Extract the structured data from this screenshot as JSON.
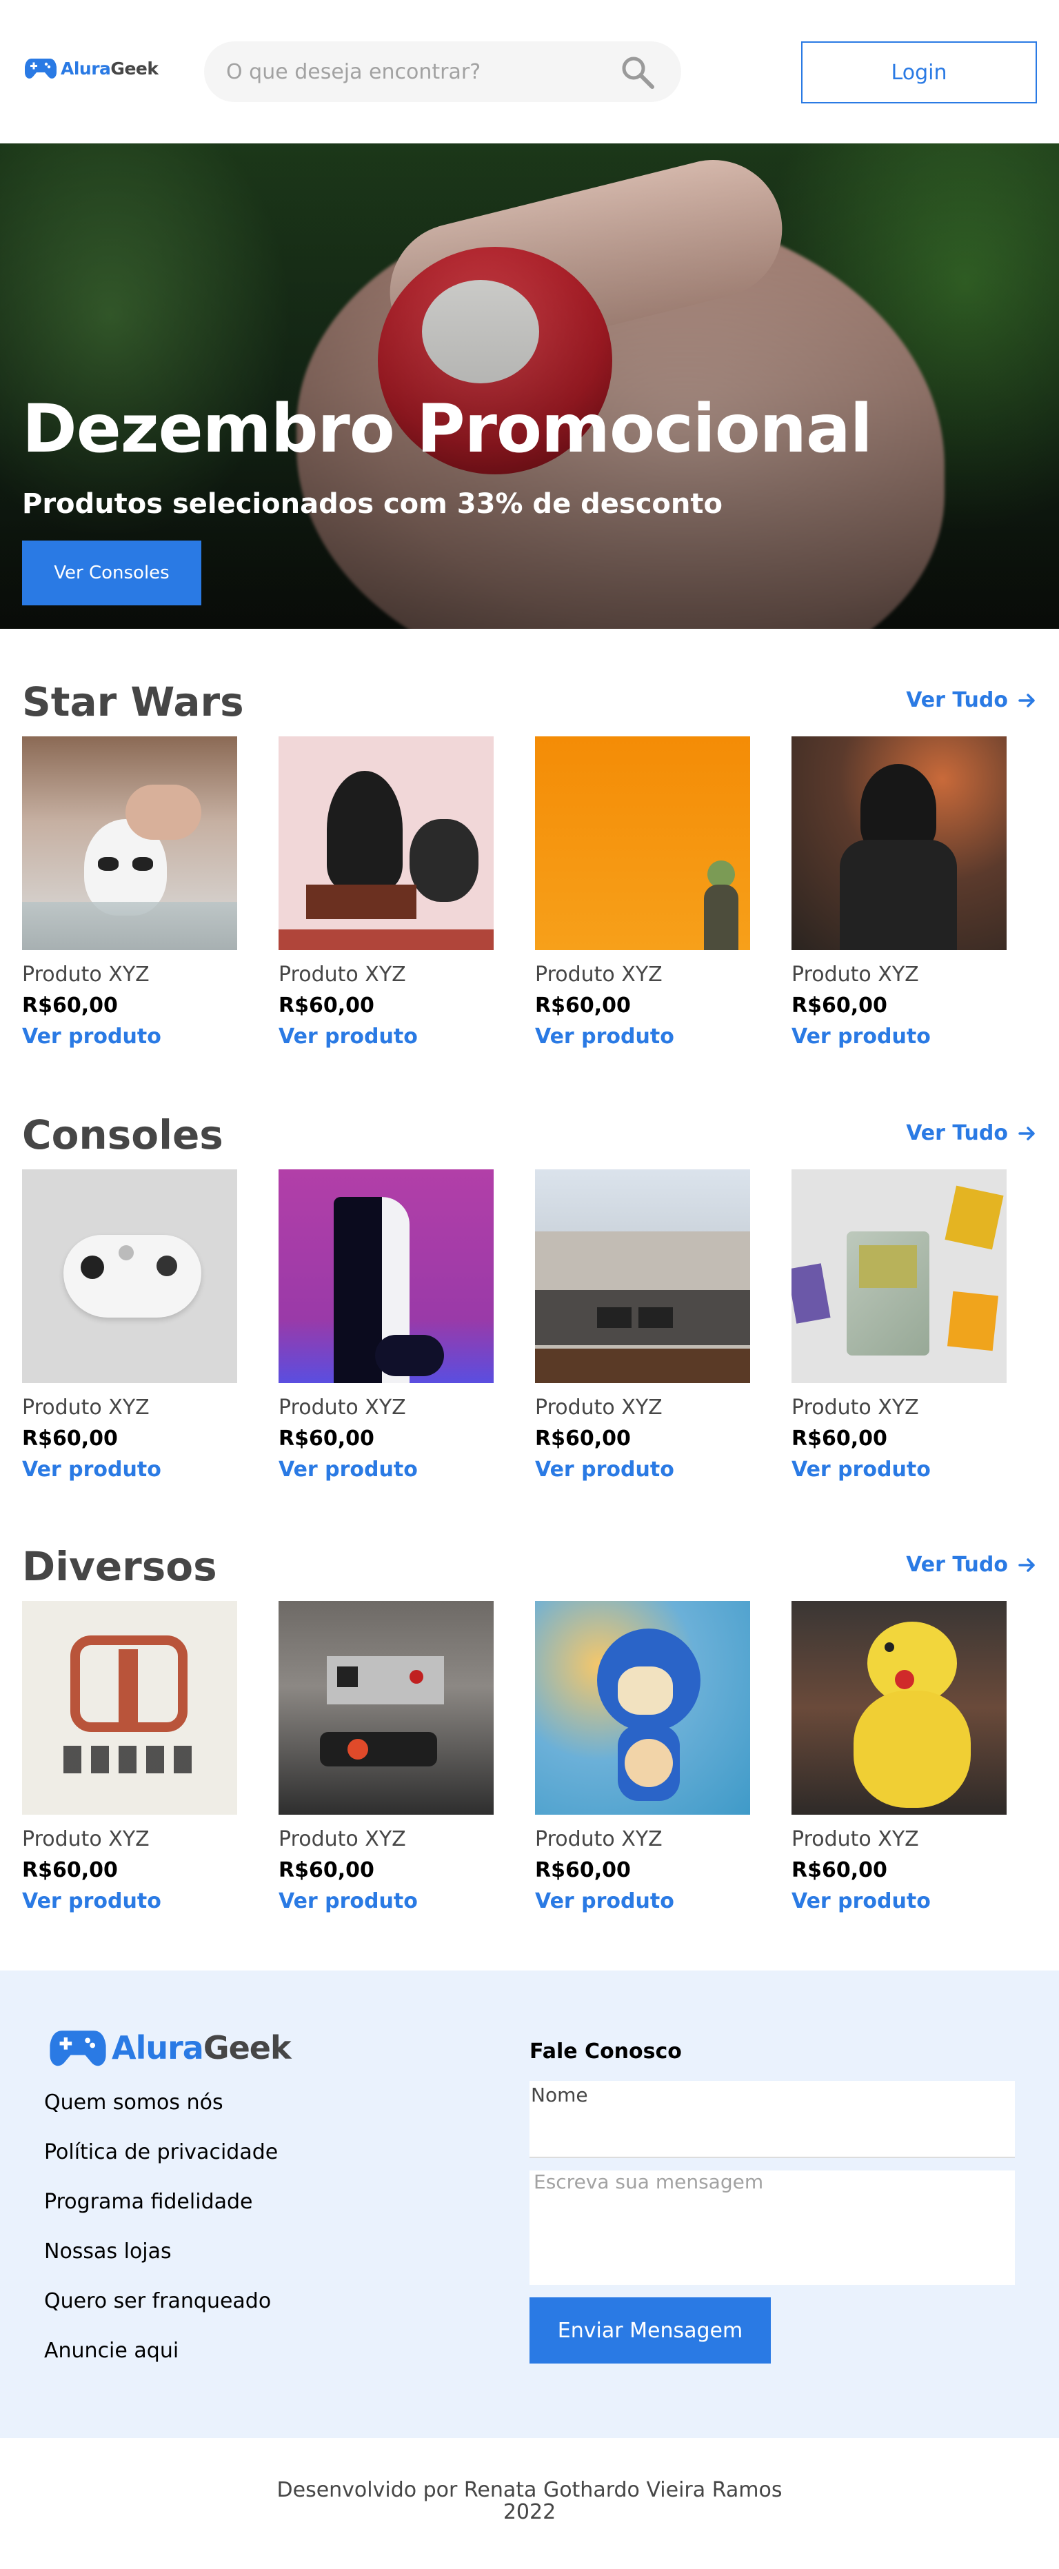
{
  "header": {
    "logo": {
      "part1": "Alura",
      "part2": "Geek"
    },
    "search": {
      "placeholder": "O que deseja encontrar?"
    },
    "login_label": "Login"
  },
  "hero": {
    "title": "Dezembro Promocional",
    "subtitle": "Produtos selecionados com 33% de desconto",
    "button_label": "Ver Consoles"
  },
  "sections": [
    {
      "title": "Star Wars",
      "see_all": "Ver Tudo",
      "products": [
        {
          "name": "Produto XYZ",
          "price": "R$60,00",
          "link": "Ver produto"
        },
        {
          "name": "Produto XYZ",
          "price": "R$60,00",
          "link": "Ver produto"
        },
        {
          "name": "Produto XYZ",
          "price": "R$60,00",
          "link": "Ver produto"
        },
        {
          "name": "Produto XYZ",
          "price": "R$60,00",
          "link": "Ver produto"
        }
      ]
    },
    {
      "title": "Consoles",
      "see_all": "Ver Tudo",
      "products": [
        {
          "name": "Produto XYZ",
          "price": "R$60,00",
          "link": "Ver produto"
        },
        {
          "name": "Produto XYZ",
          "price": "R$60,00",
          "link": "Ver produto"
        },
        {
          "name": "Produto XYZ",
          "price": "R$60,00",
          "link": "Ver produto"
        },
        {
          "name": "Produto XYZ",
          "price": "R$60,00",
          "link": "Ver produto"
        }
      ]
    },
    {
      "title": "Diversos",
      "see_all": "Ver Tudo",
      "products": [
        {
          "name": "Produto XYZ",
          "price": "R$60,00",
          "link": "Ver produto"
        },
        {
          "name": "Produto XYZ",
          "price": "R$60,00",
          "link": "Ver produto"
        },
        {
          "name": "Produto XYZ",
          "price": "R$60,00",
          "link": "Ver produto"
        },
        {
          "name": "Produto XYZ",
          "price": "R$60,00",
          "link": "Ver produto"
        }
      ]
    }
  ],
  "footer": {
    "logo": {
      "part1": "Alura",
      "part2": "Geek"
    },
    "links": [
      "Quem somos nós",
      "Política de privacidade",
      "Programa fidelidade",
      "Nossas lojas",
      "Quero ser franqueado",
      "Anuncie aqui"
    ],
    "form_title": "Fale Conosco",
    "name_label": "Nome",
    "message_placeholder": "Escreva sua mensagem",
    "send_label": "Enviar Mensagem"
  },
  "credits": {
    "line1": "Desenvolvido por Renata Gothardo Vieira Ramos",
    "line2": "2022"
  },
  "colors": {
    "accent": "#2a7ae4",
    "text": "#464646",
    "footer_bg": "#eaf2fd"
  }
}
